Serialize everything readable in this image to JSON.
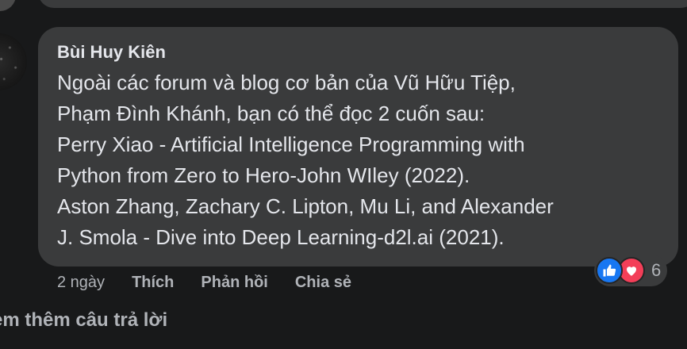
{
  "comment": {
    "author": "Bùi Huy Kiên",
    "text_lines": [
      "Ngoài các forum và blog cơ bản của Vũ Hữu Tiệp,",
      "Phạm Đình Khánh, bạn có thể đọc 2 cuốn sau:",
      "Perry Xiao - Artificial Intelligence Programming with",
      "Python from Zero to Hero-John WIley (2022).",
      "Aston Zhang, Zachary C. Lipton, Mu Li, and Alexander",
      "J. Smola - Dive into Deep Learning-d2l.ai (2021)."
    ],
    "time": "2 ngày",
    "actions": {
      "like": "Thích",
      "reply": "Phản hồi",
      "share": "Chia sẻ"
    },
    "reactions": {
      "icons": [
        "like-icon",
        "love-icon"
      ],
      "count": "6"
    }
  },
  "more_replies": "em thêm câu trả lời",
  "colors": {
    "background": "#18191a",
    "bubble": "#3a3b3c",
    "text": "#e4e6eb",
    "secondary_text": "#b0b3b8",
    "like": "#1877f2",
    "love": "#f33e58"
  }
}
